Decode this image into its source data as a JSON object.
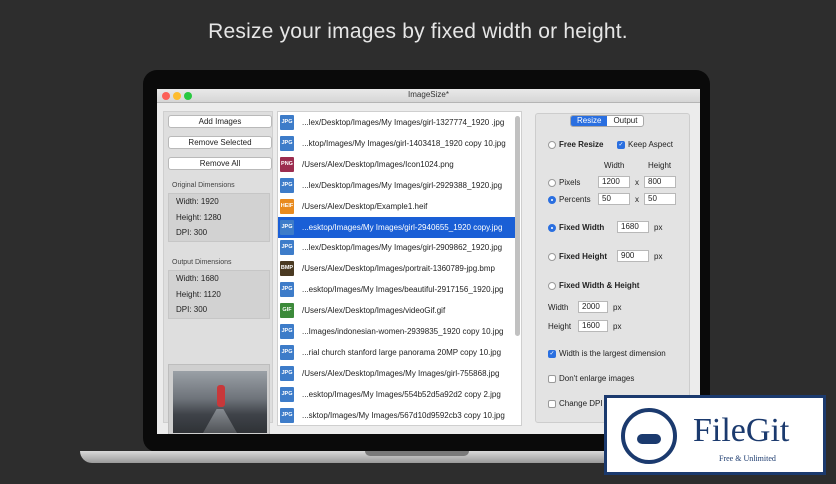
{
  "headline": "Resize your images by fixed width or height.",
  "window": {
    "title": "ImageSize*"
  },
  "left": {
    "add_images": "Add Images",
    "remove_selected": "Remove Selected",
    "remove_all": "Remove All",
    "original_title": "Original Dimensions",
    "original": [
      "Width: 1920",
      "Height: 1280",
      "DPI: 300"
    ],
    "output_title": "Output Dimensions",
    "output": [
      "Width: 1680",
      "Height: 1120",
      "DPI: 300"
    ]
  },
  "files": [
    {
      "type": "JPG",
      "color": "#3d7cc9",
      "name": "...lex/Desktop/Images/My Images/girl-1327774_1920 .jpg"
    },
    {
      "type": "JPG",
      "color": "#3d7cc9",
      "name": "...ktop/Images/My Images/girl-1403418_1920 copy 10.jpg"
    },
    {
      "type": "PNG",
      "color": "#9c2d4f",
      "name": "/Users/Alex/Desktop/Images/Icon1024.png"
    },
    {
      "type": "JPG",
      "color": "#3d7cc9",
      "name": "...lex/Desktop/Images/My Images/girl-2929388_1920.jpg"
    },
    {
      "type": "HEIF",
      "color": "#e88a1e",
      "name": "/Users/Alex/Desktop/Example1.heif"
    },
    {
      "type": "JPG",
      "color": "#3d7cc9",
      "name": "...esktop/Images/My Images/girl-2940655_1920 copy.jpg",
      "selected": true
    },
    {
      "type": "JPG",
      "color": "#3d7cc9",
      "name": "...lex/Desktop/Images/My Images/girl-2909862_1920.jpg"
    },
    {
      "type": "BMP",
      "color": "#4a3a22",
      "name": "/Users/Alex/Desktop/Images/portrait-1360789-jpg.bmp"
    },
    {
      "type": "JPG",
      "color": "#3d7cc9",
      "name": "...esktop/Images/My Images/beautiful-2917156_1920.jpg"
    },
    {
      "type": "GIF",
      "color": "#3c8a3a",
      "name": "/Users/Alex/Desktop/Images/videoGif.gif"
    },
    {
      "type": "JPG",
      "color": "#3d7cc9",
      "name": "...Images/indonesian-women-2939835_1920 copy 10.jpg"
    },
    {
      "type": "JPG",
      "color": "#3d7cc9",
      "name": "...rial church stanford large panorama 20MP copy 10.jpg"
    },
    {
      "type": "JPG",
      "color": "#3d7cc9",
      "name": "/Users/Alex/Desktop/Images/My Images/girl-755868.jpg"
    },
    {
      "type": "JPG",
      "color": "#3d7cc9",
      "name": "...esktop/Images/My Images/554b52d5a92d2 copy 2.jpg"
    },
    {
      "type": "JPG",
      "color": "#3d7cc9",
      "name": "...sktop/Images/My Images/567d10d9592cb3 copy 10.jpg"
    }
  ],
  "right": {
    "tab_resize": "Resize",
    "tab_output": "Output",
    "free_resize": "Free Resize",
    "keep_aspect": "Keep Aspect",
    "col_width": "Width",
    "col_height": "Height",
    "pixels": "Pixels",
    "percents": "Percents",
    "px_w": "1200",
    "px_h": "800",
    "pc_w": "50",
    "pc_h": "50",
    "x": "x",
    "fixed_width": "Fixed Width",
    "fixed_width_val": "1680",
    "fixed_height": "Fixed Height",
    "fixed_height_val": "900",
    "px": "px",
    "fixed_wh": "Fixed Width & Height",
    "fwh_width_label": "Width",
    "fwh_width": "2000",
    "fwh_height_label": "Height",
    "fwh_height": "1600",
    "largest_dim": "Width is the largest dimension",
    "dont_enlarge": "Don't enlarge images",
    "change_dpi": "Change DPI"
  },
  "watermark": {
    "name": "FileGit",
    "tagline": "Free & Unlimited"
  }
}
